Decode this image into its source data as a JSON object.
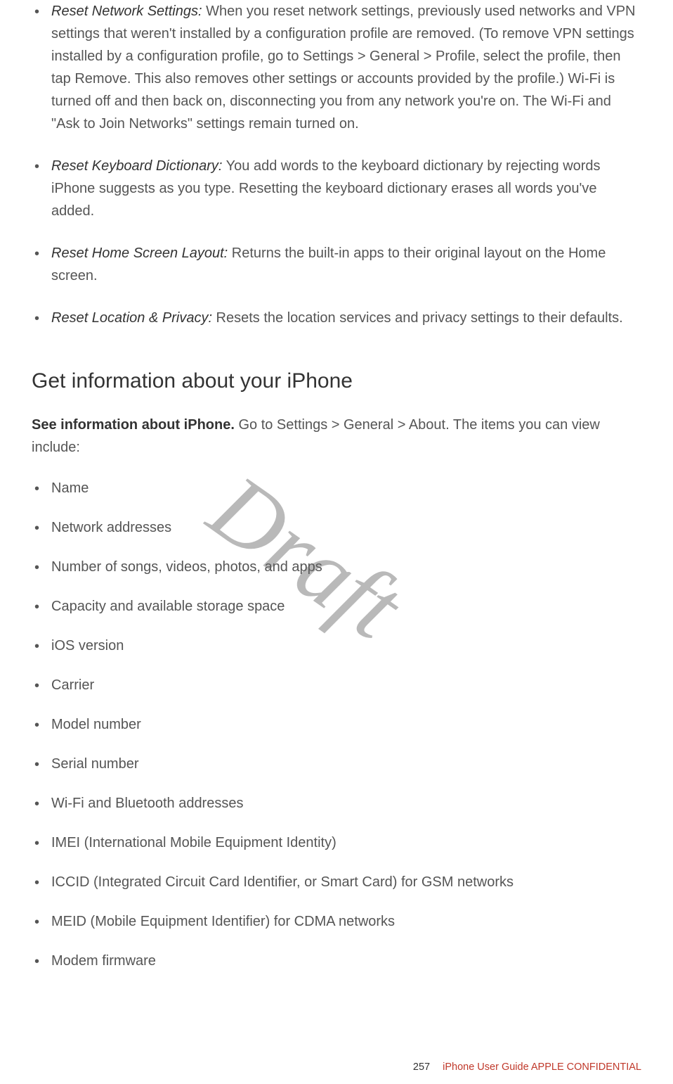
{
  "reset_items": [
    {
      "term": "Reset Network Settings:",
      "text": " When you reset network settings, previously used networks and VPN settings that weren't installed by a configuration profile are removed. (To remove VPN settings installed by a configuration profile, go to Settings > General > Profile, select the profile, then tap Remove. This also removes other settings or accounts provided by the profile.) Wi-Fi is turned off and then back on, disconnecting you from any network you're on. The Wi-Fi and \"Ask to Join Networks\" settings remain turned on."
    },
    {
      "term": "Reset Keyboard Dictionary:",
      "text": " You add words to the keyboard dictionary by rejecting words iPhone suggests as you type. Resetting the keyboard dictionary erases all words you've added."
    },
    {
      "term": "Reset Home Screen Layout:",
      "text": " Returns the built-in apps to their original layout on the Home screen."
    },
    {
      "term": "Reset Location & Privacy:",
      "text": " Resets the location services and privacy settings to their defaults."
    }
  ],
  "heading": "Get information about your iPhone",
  "intro_bold": "See information about iPhone.",
  "intro_rest": " Go to Settings > General > About. The items you can view include:",
  "info_items": [
    "Name",
    "Network addresses",
    "Number of songs, videos, photos, and apps",
    "Capacity and available storage space",
    "iOS version",
    "Carrier",
    "Model number",
    "Serial number",
    "Wi-Fi and Bluetooth addresses",
    "IMEI (International Mobile Equipment Identity)",
    "ICCID (Integrated Circuit Card Identifier, or Smart Card) for GSM networks",
    "MEID (Mobile Equipment Identifier) for CDMA networks",
    "Modem firmware"
  ],
  "watermark": "Draft",
  "footer": {
    "page": "257",
    "guide": "iPhone User Guide",
    "confidential": "  APPLE CONFIDENTIAL"
  }
}
